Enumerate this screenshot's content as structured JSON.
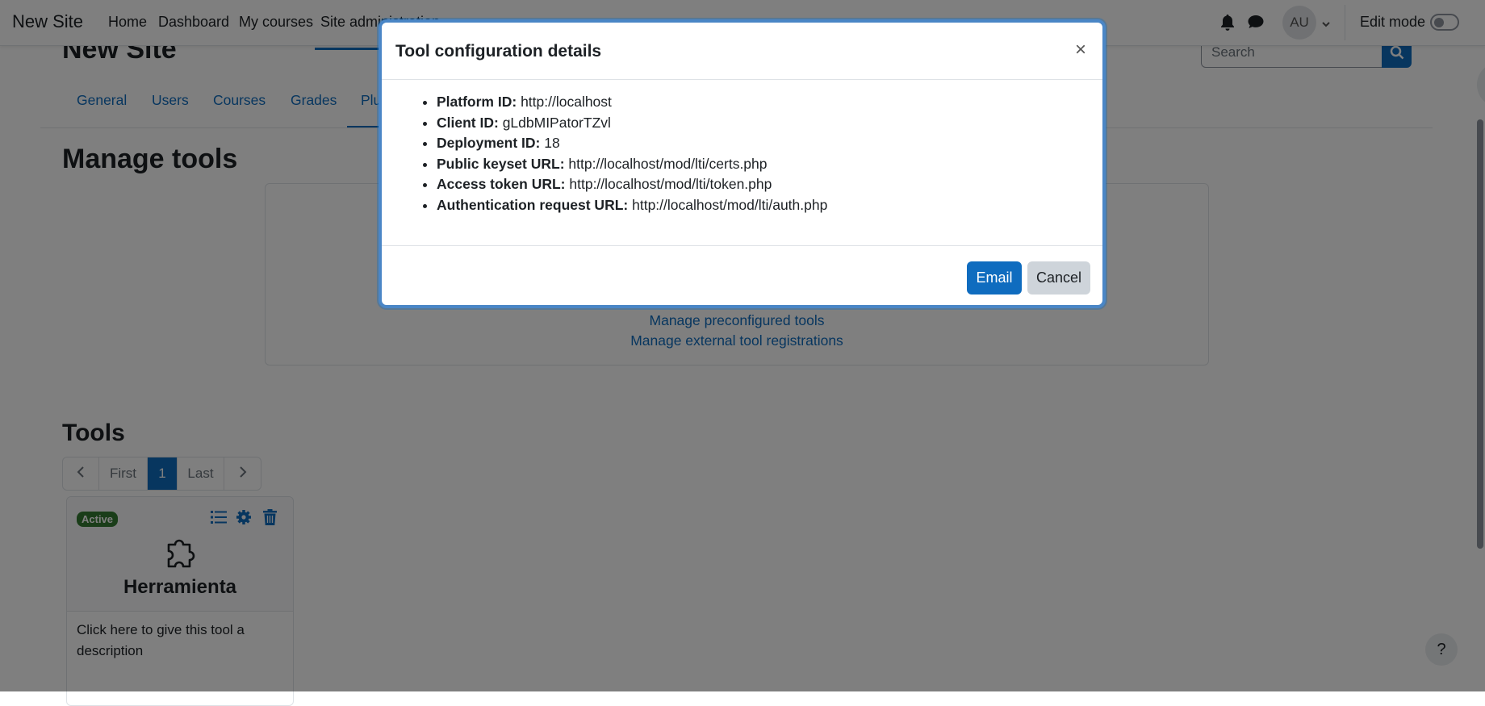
{
  "navbar": {
    "brand": "New Site",
    "links": [
      "Home",
      "Dashboard",
      "My courses",
      "Site administration"
    ],
    "avatar_initials": "AU",
    "edit_mode_label": "Edit mode"
  },
  "page": {
    "site_title": "New Site",
    "search_placeholder": "Search",
    "tabs": [
      "General",
      "Users",
      "Courses",
      "Grades",
      "Plu"
    ],
    "heading": "Manage tools",
    "panel_links": [
      "Manage preconfigured tools",
      "Manage external tool registrations"
    ],
    "tools_heading": "Tools",
    "pager": {
      "first": "First",
      "current": "1",
      "last": "Last"
    },
    "tool_card": {
      "badge": "Active",
      "title": "Herramienta",
      "description": "Click here to give this tool a description"
    },
    "help": "?"
  },
  "modal": {
    "title": "Tool configuration details",
    "close": "×",
    "items": [
      {
        "label": "Platform ID:",
        "value": "http://localhost"
      },
      {
        "label": "Client ID:",
        "value": "gLdbMIPatorTZvl"
      },
      {
        "label": "Deployment ID:",
        "value": "18"
      },
      {
        "label": "Public keyset URL:",
        "value": "http://localhost/mod/lti/certs.php"
      },
      {
        "label": "Access token URL:",
        "value": "http://localhost/mod/lti/token.php"
      },
      {
        "label": "Authentication request URL:",
        "value": "http://localhost/mod/lti/auth.php"
      }
    ],
    "email_button": "Email",
    "cancel_button": "Cancel"
  },
  "colors": {
    "primary": "#0f6cbf",
    "success_badge": "#357a32",
    "backdrop": "rgba(0,0,0,0.5)"
  },
  "icons": [
    "bell-icon",
    "chat-icon",
    "chevron-down-icon",
    "search-icon",
    "chevron-left-icon",
    "chevron-right-icon",
    "list-icon",
    "gear-icon",
    "trash-icon",
    "puzzle-icon",
    "close-icon"
  ]
}
